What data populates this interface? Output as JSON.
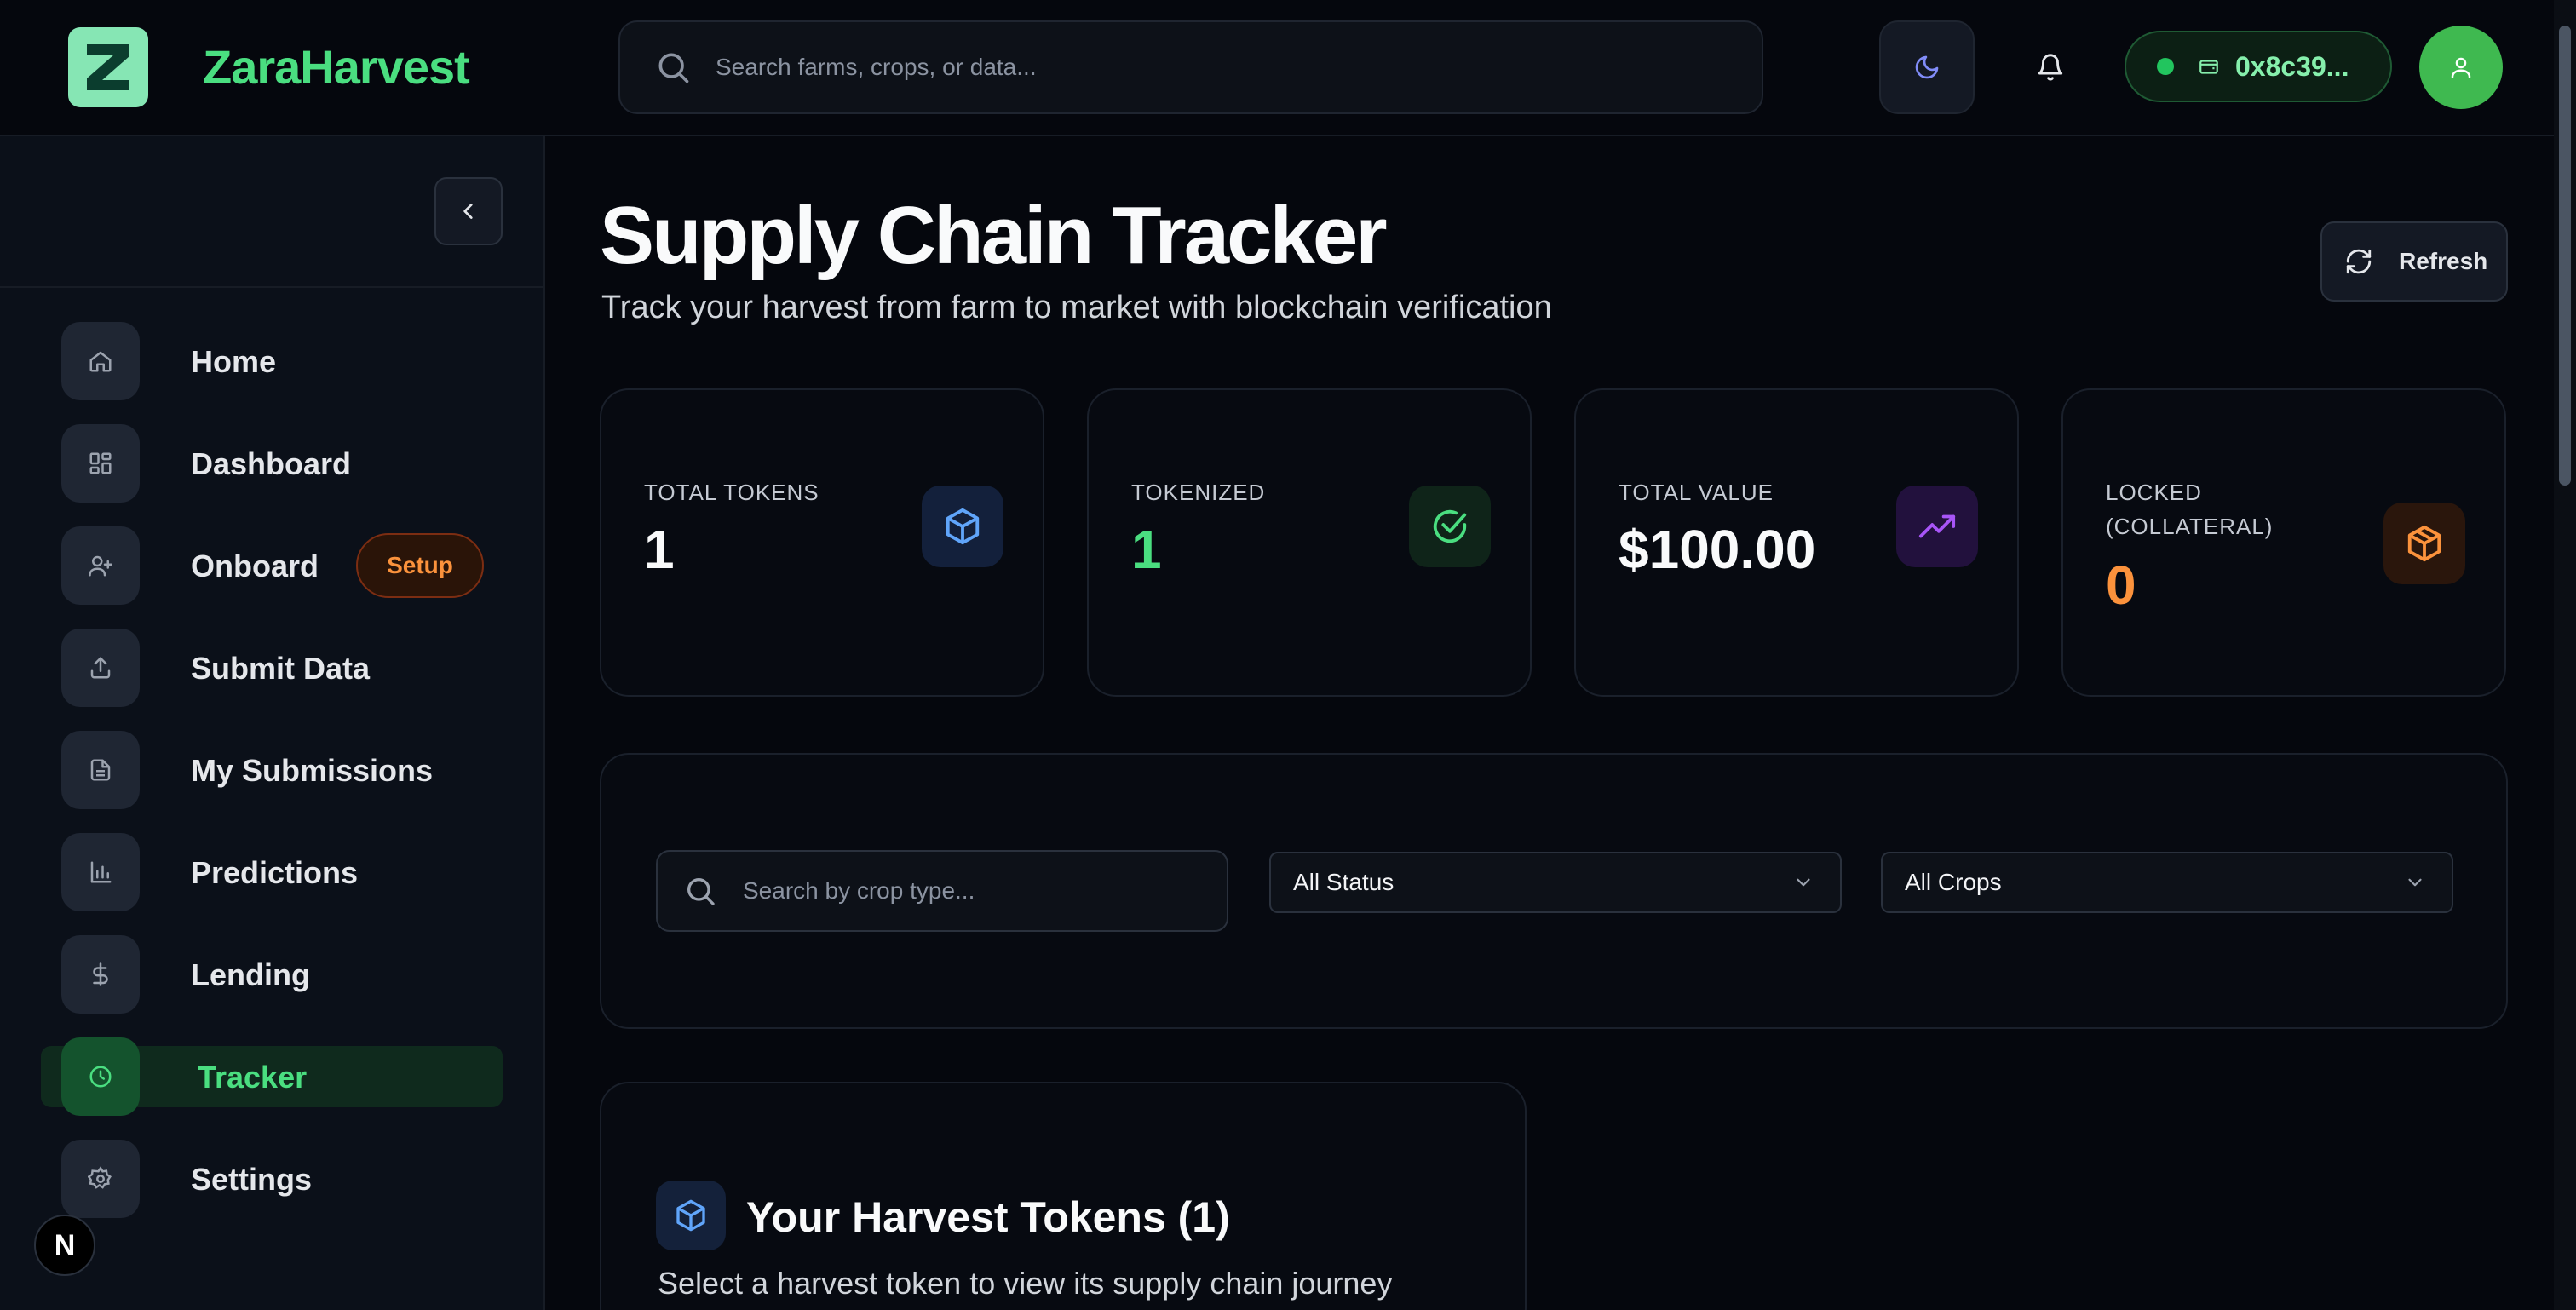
{
  "app": {
    "brand": "ZaraHarvest"
  },
  "header": {
    "search_placeholder": "Search farms, crops, or data...",
    "wallet_address": "0x8c39..."
  },
  "sidebar": {
    "items": [
      {
        "label": "Home",
        "icon": "home-icon"
      },
      {
        "label": "Dashboard",
        "icon": "dashboard-icon"
      },
      {
        "label": "Onboard",
        "icon": "user-plus-icon",
        "badge": "Setup"
      },
      {
        "label": "Submit Data",
        "icon": "upload-icon"
      },
      {
        "label": "My Submissions",
        "icon": "document-icon"
      },
      {
        "label": "Predictions",
        "icon": "bar-chart-icon"
      },
      {
        "label": "Lending",
        "icon": "dollar-icon"
      },
      {
        "label": "Tracker",
        "icon": "clock-icon",
        "active": true
      },
      {
        "label": "Settings",
        "icon": "gear-icon"
      }
    ],
    "next_badge": "N"
  },
  "main": {
    "title": "Supply Chain Tracker",
    "subtitle": "Track your harvest from farm to market with blockchain verification",
    "refresh_label": "Refresh",
    "stats": [
      {
        "label": "TOTAL TOKENS",
        "value": "1",
        "icon": "cube-icon",
        "value_color": "#f9fafb",
        "icon_color": "#60a5fa",
        "icon_bg": "#13203b"
      },
      {
        "label": "TOKENIZED",
        "value": "1",
        "icon": "check-circle-icon",
        "value_color": "#4ade80",
        "icon_color": "#4ade80",
        "icon_bg": "#0f2419"
      },
      {
        "label": "TOTAL VALUE",
        "value": "$100.00",
        "icon": "trending-up-icon",
        "value_color": "#f9fafb",
        "icon_color": "#a855f7",
        "icon_bg": "#22113d"
      },
      {
        "label": "LOCKED (COLLATERAL)",
        "value": "0",
        "icon": "package-icon",
        "value_color": "#fb923c",
        "icon_color": "#fb923c",
        "icon_bg": "#2a160c"
      }
    ],
    "filters": {
      "search_placeholder": "Search by crop type...",
      "status_selected": "All Status",
      "crops_selected": "All Crops"
    },
    "tokens_panel": {
      "title": "Your Harvest Tokens (1)",
      "subtitle": "Select a harvest token to view its supply chain journey"
    }
  },
  "colors": {
    "accent_green": "#4ade80",
    "background": "#05070d",
    "setup_orange": "#fb923c"
  }
}
